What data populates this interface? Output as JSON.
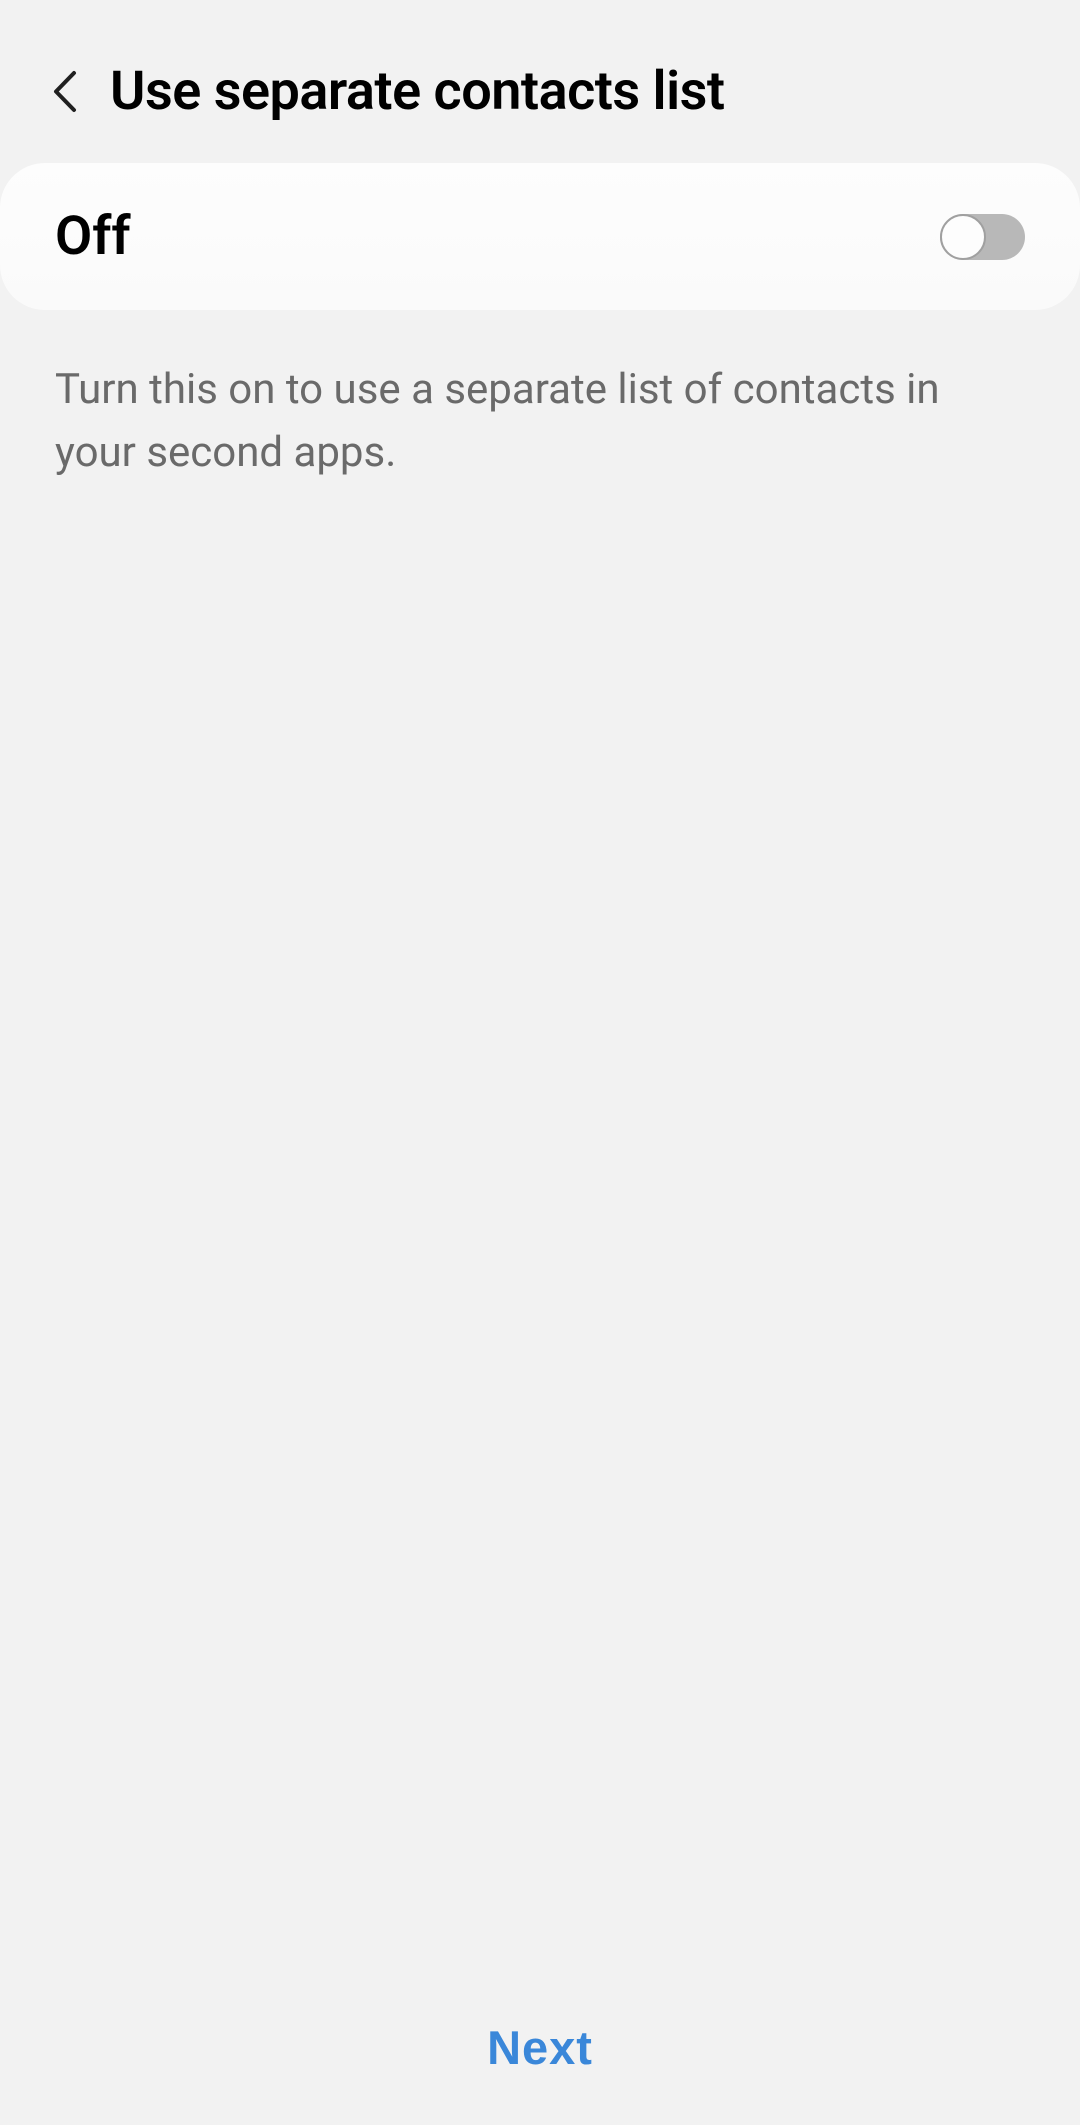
{
  "header": {
    "title": "Use separate contacts list"
  },
  "toggle": {
    "state_label": "Off",
    "enabled": false
  },
  "description": {
    "text": "Turn this on to use a separate list of contacts in your second apps."
  },
  "footer": {
    "next_label": "Next"
  }
}
